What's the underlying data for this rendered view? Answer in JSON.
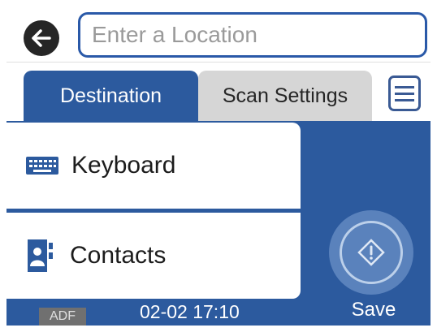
{
  "header": {
    "back_icon": "arrow-left-icon",
    "location_placeholder": "Enter a Location",
    "location_value": ""
  },
  "tabs": [
    {
      "label": "Destination",
      "active": true
    },
    {
      "label": "Scan Settings",
      "active": false
    }
  ],
  "menu_icon": "list-menu-icon",
  "destinations": [
    {
      "label": "Keyboard",
      "icon": "keyboard-icon"
    },
    {
      "label": "Contacts",
      "icon": "contacts-book-icon"
    }
  ],
  "status": {
    "source": "ADF",
    "datetime": "02-02 17:10"
  },
  "start": {
    "icon": "start-diamond-icon",
    "save_label": "Save"
  },
  "colors": {
    "accent_blue": "#2c5a9e",
    "inactive_tab": "#d6d6d6",
    "start_button": "#5a82bc"
  }
}
